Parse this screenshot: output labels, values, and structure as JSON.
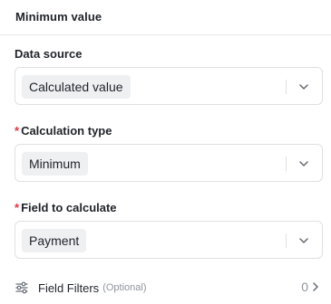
{
  "panel": {
    "title": "Minimum value"
  },
  "fields": [
    {
      "label": "Data source",
      "required": false,
      "value": "Calculated value"
    },
    {
      "label": "Calculation type",
      "required": true,
      "value": "Minimum"
    },
    {
      "label": "Field to calculate",
      "required": true,
      "value": "Payment"
    }
  ],
  "required_mark": "*",
  "filters": {
    "label": "Field Filters",
    "optional_label": "(Optional)",
    "count": "0"
  },
  "icons": {
    "select_arrow": "chevron-down-icon",
    "filters": "filter-sliders-icon",
    "filters_arrow": "chevron-right-icon"
  },
  "colors": {
    "required": "#e5323f",
    "chip_bg": "#eef0f2",
    "border": "#dee0e3"
  }
}
